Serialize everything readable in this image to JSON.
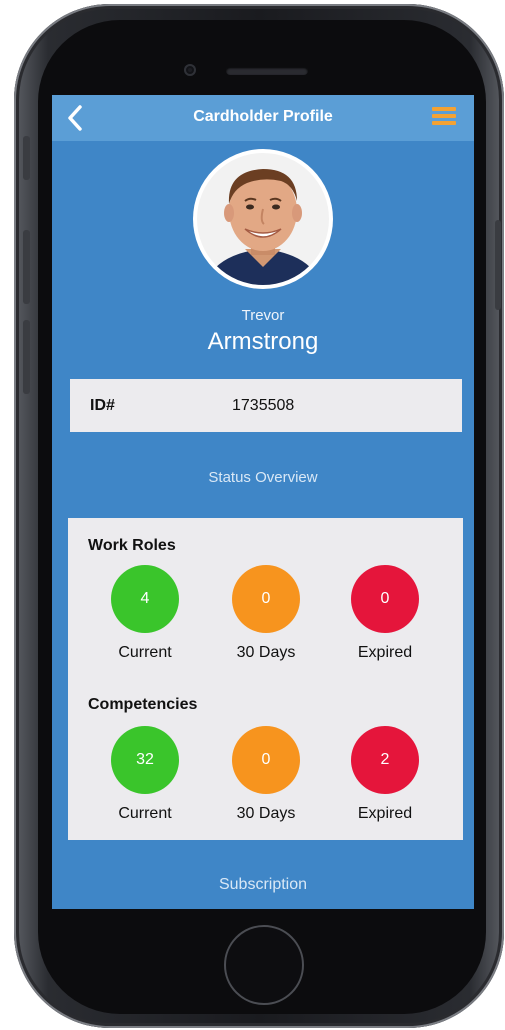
{
  "header": {
    "back_icon": "chevron-left-icon",
    "title": "Cardholder Profile",
    "menu_icon": "hamburger-menu-icon"
  },
  "profile": {
    "first_name": "Trevor",
    "last_name": "Armstrong"
  },
  "id_card": {
    "label": "ID#",
    "value": "1735508"
  },
  "status_overview_label": "Status Overview",
  "sections": {
    "work_roles": {
      "title": "Work Roles",
      "current": {
        "count": "4",
        "label": "Current"
      },
      "days30": {
        "count": "0",
        "label": "30 Days"
      },
      "expired": {
        "count": "0",
        "label": "Expired"
      }
    },
    "competencies": {
      "title": "Competencies",
      "current": {
        "count": "32",
        "label": "Current"
      },
      "days30": {
        "count": "0",
        "label": "30 Days"
      },
      "expired": {
        "count": "2",
        "label": "Expired"
      }
    }
  },
  "subscription_label": "Subscription",
  "colors": {
    "screen_bg": "#3f86c7",
    "nav_bg": "#5b9ed6",
    "current": "#3ac52b",
    "days30": "#f7941e",
    "expired": "#e5153b",
    "menu_accent": "#f4a233"
  }
}
